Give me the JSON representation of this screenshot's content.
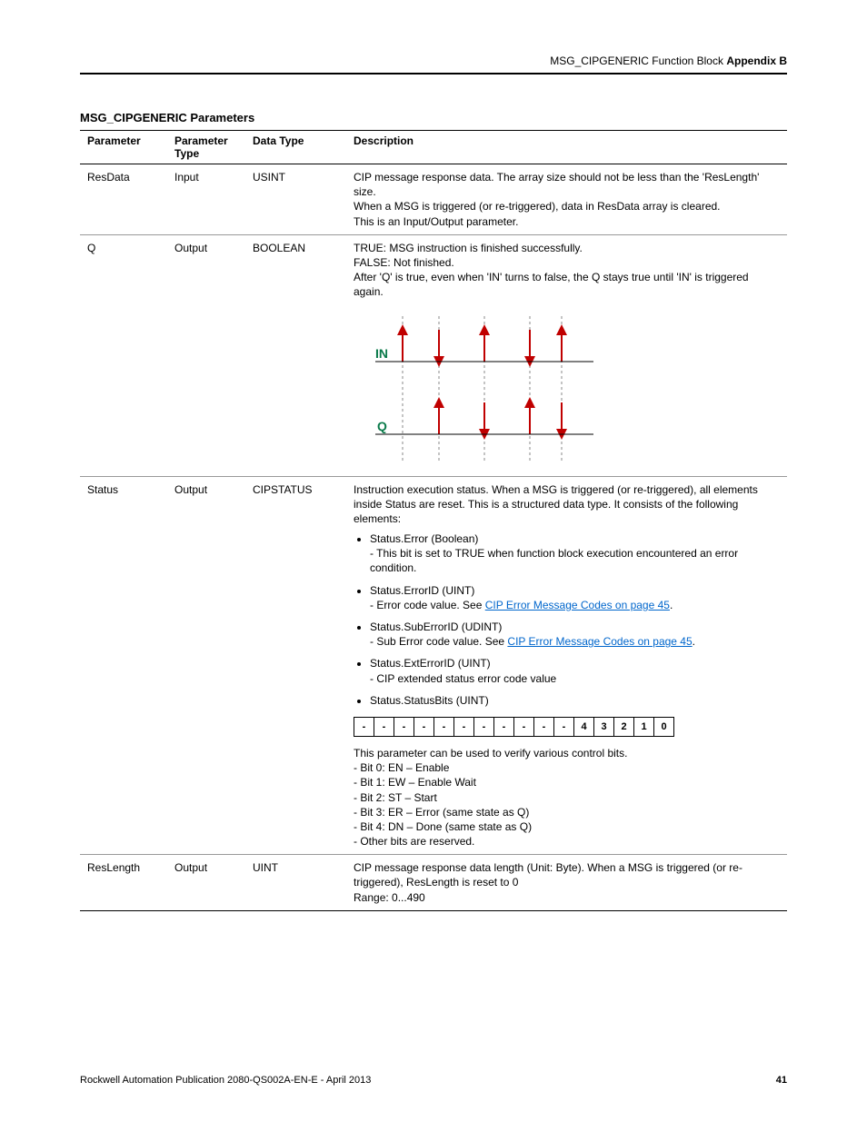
{
  "header": {
    "left": "MSG_CIPGENERIC Function Block",
    "right": "Appendix B"
  },
  "section_title": "MSG_CIPGENERIC Parameters",
  "columns": {
    "c1": "Parameter",
    "c2": "Parameter Type",
    "c3": "Data Type",
    "c4": "Description"
  },
  "rows": {
    "r0": {
      "param": "ResData",
      "ptype": "Input",
      "dtype": "USINT",
      "d1": "CIP message response data. The array size should not be less than the 'ResLength' size.",
      "d2": "When a MSG is triggered (or re-triggered), data in ResData array is cleared.",
      "d3": "This is an Input/Output parameter."
    },
    "r1": {
      "param": "Q",
      "ptype": "Output",
      "dtype": "BOOLEAN",
      "d1": "TRUE: MSG instruction is finished successfully.",
      "d2": "FALSE: Not finished.",
      "d3": "After 'Q' is true, even when 'IN' turns to false, the Q stays true until 'IN' is triggered again.",
      "diag_in": "IN",
      "diag_q": "Q"
    },
    "r2": {
      "param": "Status",
      "ptype": "Output",
      "dtype": "CIPSTATUS",
      "intro": "Instruction execution status. When a MSG is triggered (or re-triggered), all elements inside Status are reset. This is a structured data type. It consists of the following elements:",
      "b1a": "Status.Error (Boolean)",
      "b1b": "- This bit is set to TRUE when function block execution encountered an error condition.",
      "b2a": "Status.ErrorID (UINT)",
      "b2b_pre": "- Error code value. See ",
      "b2b_link": "CIP Error Message Codes on page 45",
      "b2b_post": ".",
      "b3a": "Status.SubErrorID (UDINT)",
      "b3b_pre": "- Sub Error code value. See ",
      "b3b_link": "CIP Error Message Codes on page 45",
      "b3b_post": ".",
      "b4a": "Status.ExtErrorID (UINT)",
      "b4b": "- CIP extended status error code value",
      "b5a": "Status.StatusBits (UINT)",
      "bits": [
        "-",
        "-",
        "-",
        "-",
        "-",
        "-",
        "-",
        "-",
        "-",
        "-",
        "-",
        "4",
        "3",
        "2",
        "1",
        "0"
      ],
      "post1": "This parameter can be used to verify various control bits.",
      "post2": "- Bit 0: EN – Enable",
      "post3": "- Bit 1: EW – Enable Wait",
      "post4": "- Bit 2: ST – Start",
      "post5": "- Bit 3: ER – Error (same state as Q)",
      "post6": "- Bit 4: DN – Done (same state as Q)",
      "post7": "- Other bits are reserved."
    },
    "r3": {
      "param": "ResLength",
      "ptype": "Output",
      "dtype": "UINT",
      "d1": "CIP message response data length (Unit: Byte). When a MSG is triggered (or re-triggered), ResLength is reset to 0",
      "d2": "Range: 0...490"
    }
  },
  "footer": {
    "left": "Rockwell Automation Publication 2080-QS002A-EN-E - April 2013",
    "page": "41"
  }
}
